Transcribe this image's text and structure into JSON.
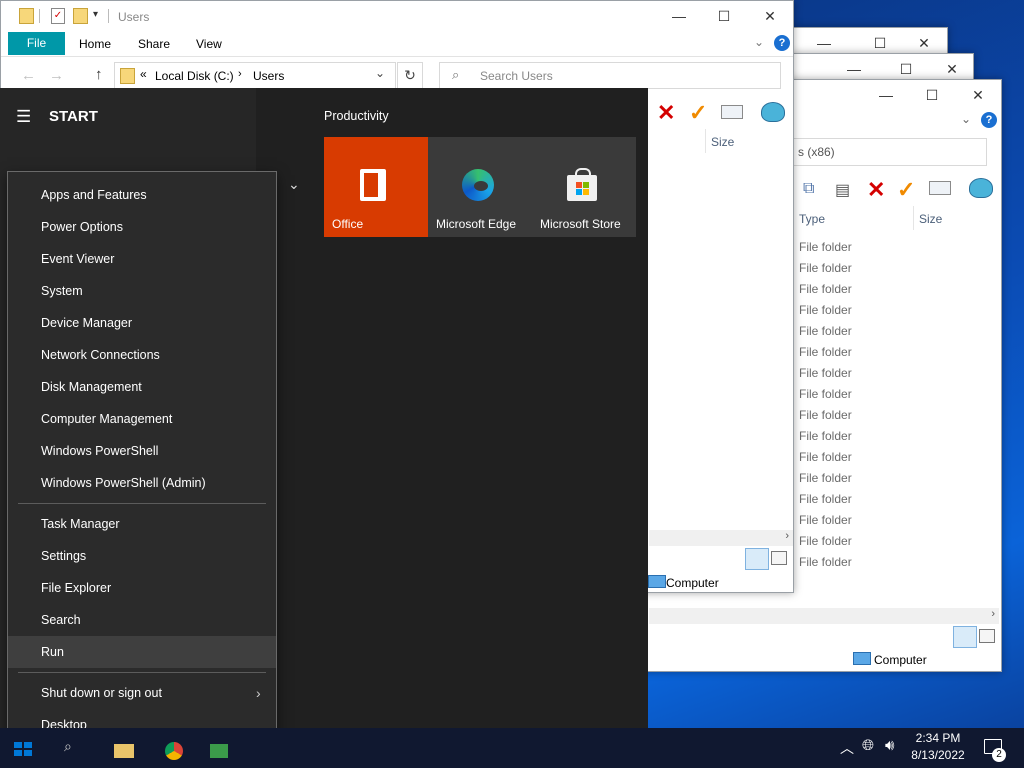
{
  "explorer": {
    "title": "Users",
    "ribbon_tabs": [
      "File",
      "Home",
      "Share",
      "View"
    ],
    "address_root": "Local Disk (C:)",
    "address_current": "Users",
    "search_placeholder": "Search Users",
    "size_header": "Size",
    "status_location": "Computer"
  },
  "explorer_back": {
    "address_fragment": "s (x86)",
    "type_header": "Type",
    "size_header": "Size",
    "row_type": "File folder",
    "row_count": 16,
    "status_location": "Computer"
  },
  "start": {
    "title": "START",
    "group_title": "Productivity",
    "tiles": [
      {
        "label": "Office",
        "color": "#d83b01",
        "icon": "office-icon"
      },
      {
        "label": "Microsoft Edge",
        "color": "#3a3a3a",
        "icon": "edge-icon"
      },
      {
        "label": "Microsoft Store",
        "color": "#3a3a3a",
        "icon": "store-icon"
      }
    ]
  },
  "winx_menu": {
    "group1": [
      "Apps and Features",
      "Power Options",
      "Event Viewer",
      "System",
      "Device Manager",
      "Network Connections",
      "Disk Management",
      "Computer Management",
      "Windows PowerShell",
      "Windows PowerShell (Admin)"
    ],
    "group2": [
      "Task Manager",
      "Settings",
      "File Explorer",
      "Search",
      "Run"
    ],
    "group3": [
      "Shut down or sign out",
      "Desktop"
    ],
    "hovered": "Run"
  },
  "taskbar": {
    "time": "2:34 PM",
    "date": "8/13/2022",
    "notification_count": "2"
  },
  "colors": {
    "accent_teal": "#0098a8",
    "office_orange": "#d83b01",
    "menu_bg": "#2b2b2b",
    "start_bg": "#202020"
  }
}
